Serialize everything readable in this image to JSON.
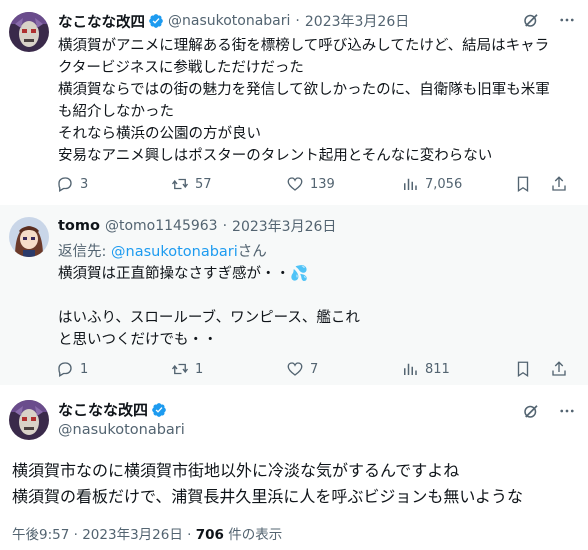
{
  "tweet1": {
    "name": "なこなな改四",
    "handle": "@nasukotonabari",
    "dot": "·",
    "date": "2023年3月26日",
    "lines": [
      "横須賀がアニメに理解ある街を標榜して呼び込みしてたけど、結局はキャラ",
      "クタービジネスに参戦しただけだった",
      "横須賀ならではの街の魅力を発信して欲しかったのに、自衛隊も旧軍も米軍",
      "も紹介しなかった",
      "それなら横浜の公園の方が良い",
      "安易なアニメ興しはポスターのタレント起用とそんなに変わらない"
    ],
    "replies": "3",
    "retweets": "57",
    "likes": "139",
    "views": "7,056"
  },
  "tweet2": {
    "name": "tomo",
    "handle": "@tomo1145963",
    "dot": "·",
    "date": "2023年3月26日",
    "reply_prefix": "返信先: ",
    "reply_mention": "@nasukotonabari",
    "reply_suffix": "さん",
    "lines": [
      "横須賀は正直節操なさすぎ感が・・💦",
      "",
      "はいふり、スロールーブ、ワンピース、艦これ",
      "と思いつくだけでも・・"
    ],
    "replies": "1",
    "retweets": "1",
    "likes": "7",
    "views": "811"
  },
  "tweet3": {
    "name": "なこなな改四",
    "handle": "@nasukotonabari",
    "lines": [
      "横須賀市なのに横須賀市街地以外に冷淡な気がするんですよね",
      "横須賀の看板だけで、浦賀長井久里浜に人を呼ぶビジョンも無いような"
    ],
    "time": "午後9:57",
    "dot": "·",
    "date": "2023年3月26日",
    "dot2": "·",
    "views": "706",
    "views_label": " 件の表示"
  },
  "colors": {
    "text": "#0f1419",
    "secondary": "#536471",
    "accent": "#1d9bf0",
    "reply_bg": "#f7f9f9"
  }
}
